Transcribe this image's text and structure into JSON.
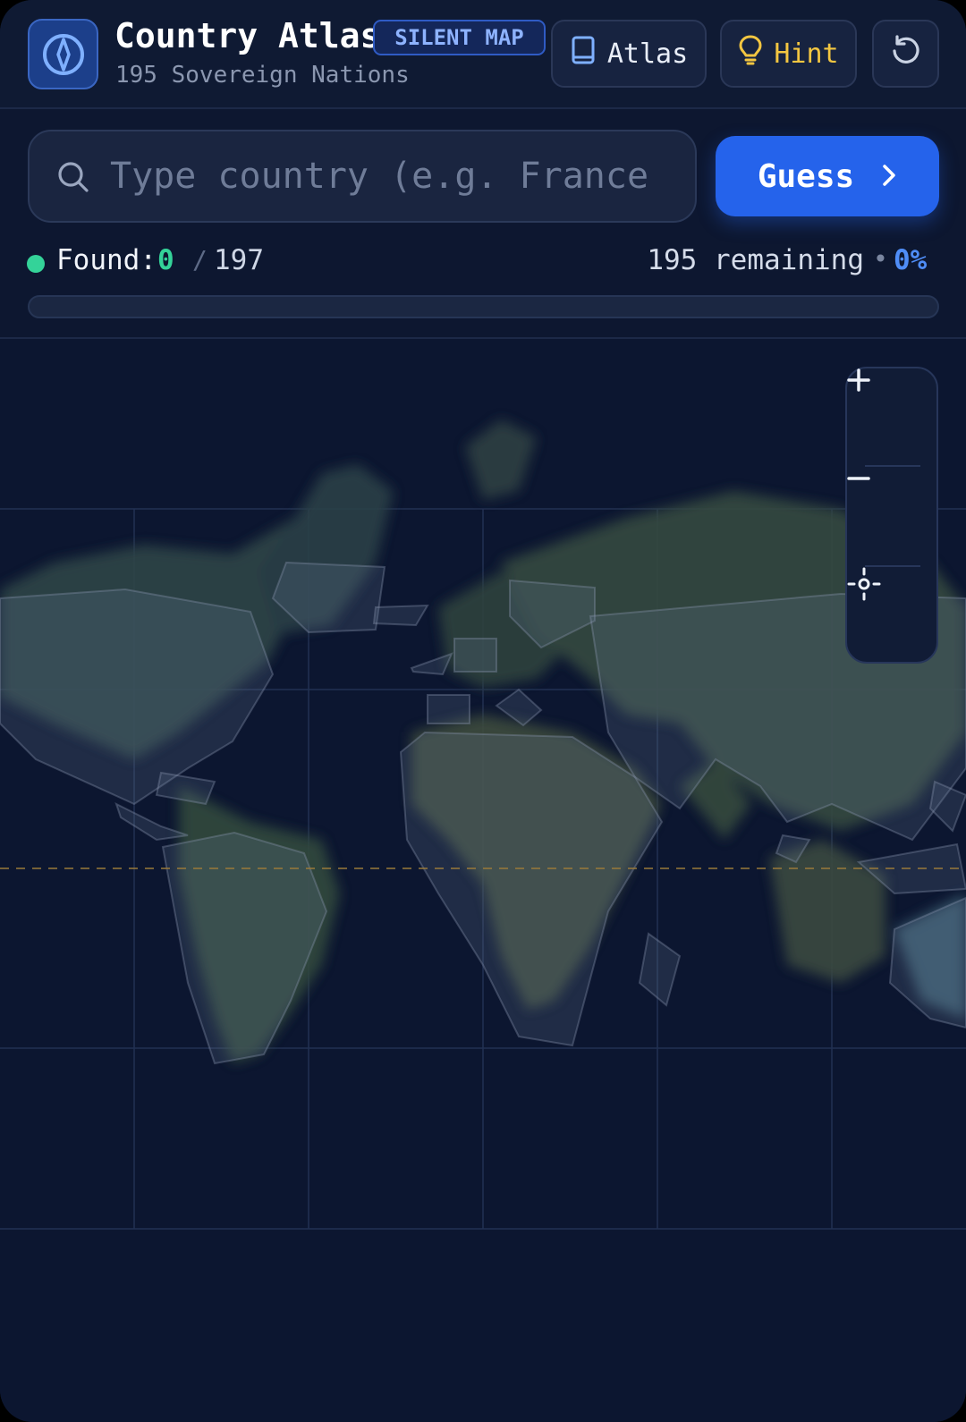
{
  "header": {
    "title": "Country Atlas",
    "badge": "SILENT MAP",
    "subtitle": "195 Sovereign Nations",
    "atlas_label": "Atlas",
    "hint_label": "Hint",
    "logo_icon": "compass-icon",
    "reset_icon": "reset-icon"
  },
  "search": {
    "placeholder": "Type country (e.g. France",
    "value": "",
    "guess_label": "Guess"
  },
  "stats": {
    "found_label": "Found:",
    "found_count": "0",
    "separator": "/",
    "total": "197",
    "remaining": "195 remaining",
    "bullet": "•",
    "percent": "0%",
    "progress": 0
  },
  "colors": {
    "accent": "#2563eb",
    "found_green": "#34d399",
    "hint_yellow": "#f3c641",
    "background": "#0d1730"
  },
  "map": {
    "controls": [
      "zoom-in-icon",
      "zoom-out-icon",
      "recenter-icon"
    ]
  }
}
